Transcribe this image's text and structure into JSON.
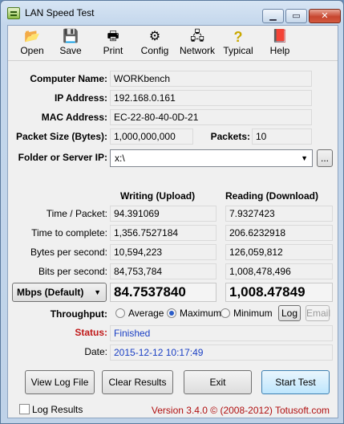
{
  "window": {
    "title": "LAN Speed Test",
    "min_icon": "minimize-icon",
    "max_icon": "maximize-icon",
    "close_icon": "close-icon"
  },
  "toolbar": [
    {
      "label": "Open",
      "icon": "folder-open-icon",
      "glyph": "📂"
    },
    {
      "label": "Save",
      "icon": "floppy-disk-icon",
      "glyph": "💾"
    },
    {
      "label": "Print",
      "icon": "printer-icon",
      "glyph": "🖶"
    },
    {
      "label": "Config",
      "icon": "config-icon",
      "glyph": "⚙"
    },
    {
      "label": "Network",
      "icon": "network-icon",
      "glyph": "🖧"
    },
    {
      "label": "Typical",
      "icon": "question-icon",
      "glyph": "?"
    },
    {
      "label": "Help",
      "icon": "help-book-icon",
      "glyph": "📕"
    }
  ],
  "info": {
    "computer_name_label": "Computer Name:",
    "computer_name": "WORKbench",
    "ip_label": "IP Address:",
    "ip": "192.168.0.161",
    "mac_label": "MAC Address:",
    "mac": "EC-22-80-40-0D-21",
    "packet_size_label": "Packet Size (Bytes):",
    "packet_size": "1,000,000,000",
    "packets_label": "Packets:",
    "packets": "10",
    "folder_label": "Folder or Server IP:",
    "folder": "x:\\",
    "browse_label": "..."
  },
  "results": {
    "writing_header": "Writing (Upload)",
    "reading_header": "Reading (Download)",
    "rows": [
      {
        "label": "Time / Packet:",
        "write": "94.391069",
        "read": "7.9327423"
      },
      {
        "label": "Time to complete:",
        "write": "1,356.7527184",
        "read": "206.6232918"
      },
      {
        "label": "Bytes per second:",
        "write": "10,594,223",
        "read": "126,059,812"
      },
      {
        "label": "Bits per second:",
        "write": "84,753,784",
        "read": "1,008,478,496"
      }
    ],
    "unit_select": "Mbps (Default)",
    "write_mbps": "84.7537840",
    "read_mbps": "1,008.47849"
  },
  "throughput": {
    "label": "Throughput:",
    "options": [
      "Average",
      "Maximum",
      "Minimum"
    ],
    "selected": "Maximum",
    "log_label": "Log",
    "email_label": "Email"
  },
  "status": {
    "label": "Status:",
    "value": "Finished",
    "date_label": "Date:",
    "date": "2015-12-12 10:17:49"
  },
  "buttons": {
    "view_log": "View Log File",
    "clear": "Clear Results",
    "exit": "Exit",
    "start": "Start Test"
  },
  "footer": {
    "log_results": "Log Results",
    "version": "Version 3.4.0  © (2008-2012) Totusoft.com"
  },
  "colors": {
    "status_label": "#c01818",
    "value_blue": "#1a3fc4"
  }
}
